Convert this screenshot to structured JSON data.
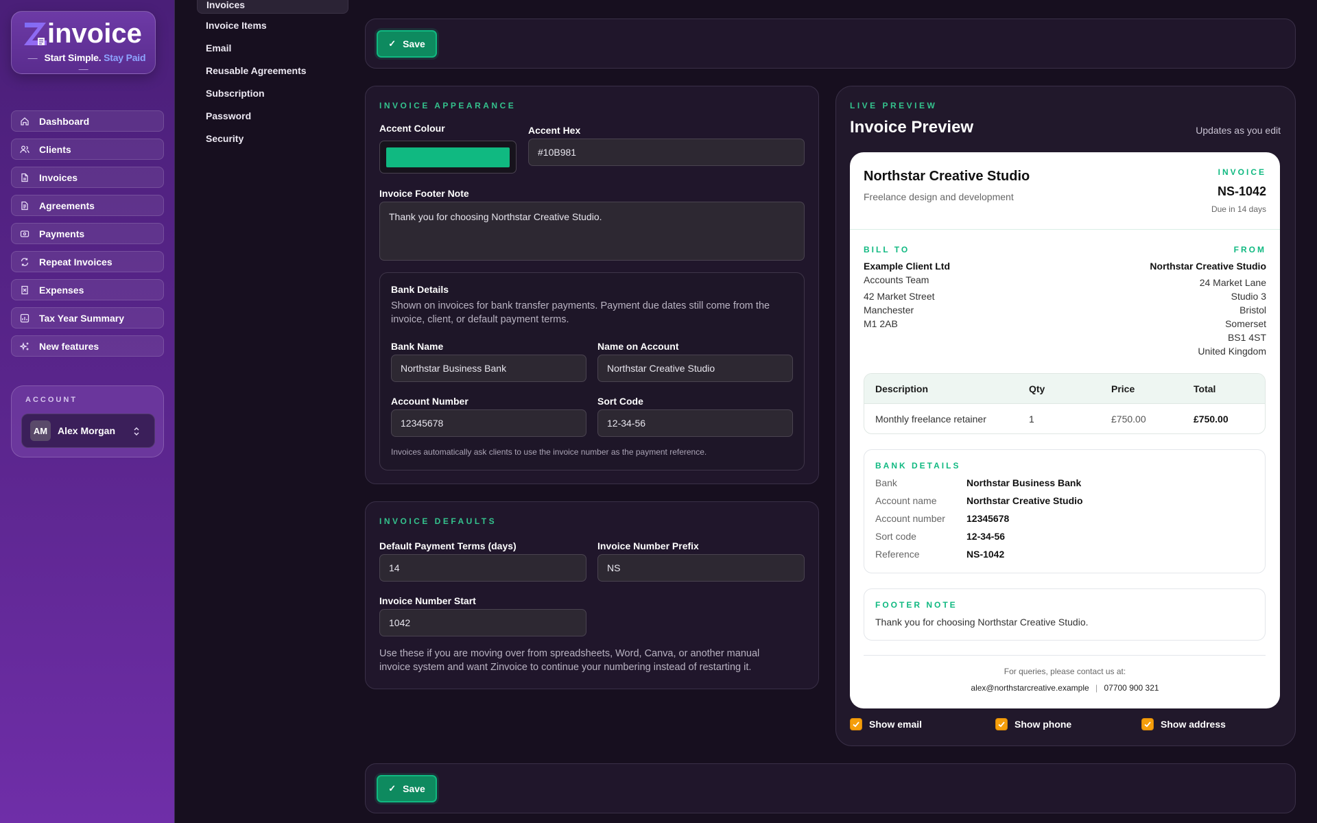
{
  "brand": {
    "name": "invoice",
    "tagline_part1": "Start Simple.",
    "tagline_part2": "Stay Paid",
    "dash": "—"
  },
  "sidebar": {
    "items": [
      {
        "label": "Dashboard",
        "icon": "home-icon"
      },
      {
        "label": "Clients",
        "icon": "users-icon"
      },
      {
        "label": "Invoices",
        "icon": "file-icon"
      },
      {
        "label": "Agreements",
        "icon": "file-text-icon"
      },
      {
        "label": "Payments",
        "icon": "wallet-icon"
      },
      {
        "label": "Repeat Invoices",
        "icon": "repeat-icon"
      },
      {
        "label": "Expenses",
        "icon": "receipt-icon"
      },
      {
        "label": "Tax Year Summary",
        "icon": "chart-icon"
      },
      {
        "label": "New features",
        "icon": "sparkles-icon"
      }
    ],
    "account": {
      "title": "ACCOUNT",
      "initials": "AM",
      "name": "Alex Morgan"
    }
  },
  "settings_nav": {
    "active": "Invoices",
    "items": [
      "Invoice Items",
      "Email",
      "Reusable Agreements",
      "Subscription",
      "Password",
      "Security"
    ]
  },
  "toolbar": {
    "save_label": "Save"
  },
  "appearance": {
    "eyebrow": "INVOICE APPEARANCE",
    "accent_colour_label": "Accent Colour",
    "accent_color": "#10B981",
    "accent_hex_label": "Accent Hex",
    "accent_hex_value": "#10B981",
    "footer_note_label": "Invoice Footer Note",
    "footer_note_value": "Thank you for choosing Northstar Creative Studio."
  },
  "bank": {
    "title": "Bank Details",
    "description": "Shown on invoices for bank transfer payments. Payment due dates still come from the invoice, client, or default payment terms.",
    "bank_name_label": "Bank Name",
    "bank_name_value": "Northstar Business Bank",
    "account_name_label": "Name on Account",
    "account_name_value": "Northstar Creative Studio",
    "account_number_label": "Account Number",
    "account_number_value": "12345678",
    "sort_code_label": "Sort Code",
    "sort_code_value": "12-34-56",
    "note": "Invoices automatically ask clients to use the invoice number as the payment reference."
  },
  "defaults": {
    "eyebrow": "INVOICE DEFAULTS",
    "terms_label": "Default Payment Terms (days)",
    "terms_value": "14",
    "prefix_label": "Invoice Number Prefix",
    "prefix_value": "NS",
    "start_label": "Invoice Number Start",
    "start_value": "1042",
    "help": "Use these if you are moving over from spreadsheets, Word, Canva, or another manual invoice system and want Zinvoice to continue your numbering instead of restarting it."
  },
  "preview": {
    "eyebrow": "LIVE PREVIEW",
    "title": "Invoice Preview",
    "updates": "Updates as you edit",
    "company": "Northstar Creative Studio",
    "company_sub": "Freelance design and development",
    "invoice_label": "INVOICE",
    "invoice_number": "NS-1042",
    "due": "Due in 14 days",
    "bill_to_label": "BILL TO",
    "bill_to": [
      "Example Client Ltd",
      "Accounts Team",
      "42 Market Street",
      "Manchester",
      "M1 2AB"
    ],
    "from_label": "FROM",
    "from": [
      "Northstar Creative Studio",
      "24 Market Lane",
      "Studio 3",
      "Bristol",
      "Somerset",
      "BS1 4ST",
      "United Kingdom"
    ],
    "table": {
      "headers": [
        "Description",
        "Qty",
        "Price",
        "Total"
      ],
      "rows": [
        [
          "Monthly freelance retainer",
          "1",
          "£750.00",
          "£750.00"
        ]
      ]
    },
    "bank_label": "BANK DETAILS",
    "bank_rows": [
      [
        "Bank",
        "Northstar Business Bank"
      ],
      [
        "Account name",
        "Northstar Creative Studio"
      ],
      [
        "Account number",
        "12345678"
      ],
      [
        "Sort code",
        "12-34-56"
      ],
      [
        "Reference",
        "NS-1042"
      ]
    ],
    "footer_label": "FOOTER NOTE",
    "footer_text": "Thank you for choosing Northstar Creative Studio.",
    "contact_intro": "For queries, please contact us at:",
    "contact_email": "alex@northstarcreative.example",
    "contact_sep": "|",
    "contact_phone": "07700 900 321"
  },
  "toggles": [
    {
      "label": "Show email",
      "checked": true
    },
    {
      "label": "Show phone",
      "checked": true
    },
    {
      "label": "Show address",
      "checked": true
    }
  ]
}
